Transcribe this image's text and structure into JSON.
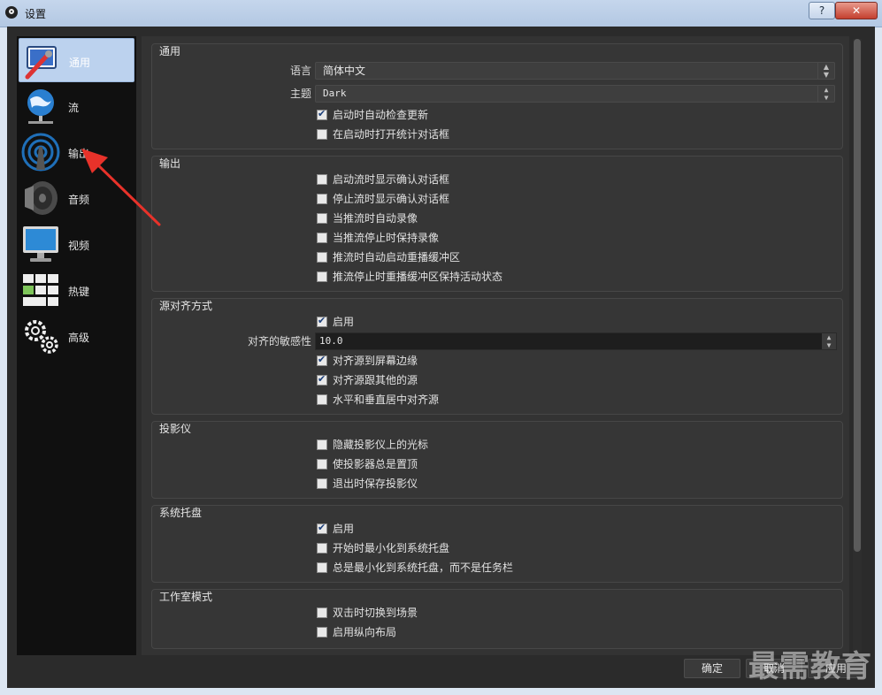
{
  "window": {
    "title": "设置",
    "help_label": "?",
    "close_label": "✕"
  },
  "sidebar": {
    "items": [
      {
        "label": "通用",
        "icon": "general-settings-icon"
      },
      {
        "label": "流",
        "icon": "globe-network-icon"
      },
      {
        "label": "输出",
        "icon": "antenna-signal-icon"
      },
      {
        "label": "音频",
        "icon": "speaker-icon"
      },
      {
        "label": "视频",
        "icon": "monitor-icon"
      },
      {
        "label": "热键",
        "icon": "keyboard-icon"
      },
      {
        "label": "高级",
        "icon": "gears-icon"
      }
    ]
  },
  "general": {
    "title": "通用",
    "language_label": "语言",
    "language_value": "简体中文",
    "theme_label": "主题",
    "theme_value": "Dark",
    "check_updates": {
      "label": "启动时自动检查更新",
      "checked": true
    },
    "open_stats": {
      "label": "在启动时打开统计对话框",
      "checked": false
    }
  },
  "output": {
    "title": "输出",
    "items": [
      {
        "label": "启动流时显示确认对话框",
        "checked": false
      },
      {
        "label": "停止流时显示确认对话框",
        "checked": false
      },
      {
        "label": "当推流时自动录像",
        "checked": false
      },
      {
        "label": "当推流停止时保持录像",
        "checked": false
      },
      {
        "label": "推流时自动启动重播缓冲区",
        "checked": false
      },
      {
        "label": "推流停止时重播缓冲区保持活动状态",
        "checked": false
      }
    ]
  },
  "snapping": {
    "title": "源对齐方式",
    "enable": {
      "label": "启用",
      "checked": true
    },
    "sensitivity_label": "对齐的敏感性",
    "sensitivity_value": "10.0",
    "items": [
      {
        "label": "对齐源到屏幕边缘",
        "checked": true
      },
      {
        "label": "对齐源跟其他的源",
        "checked": true
      },
      {
        "label": "水平和垂直居中对齐源",
        "checked": false
      }
    ]
  },
  "projector": {
    "title": "投影仪",
    "items": [
      {
        "label": "隐藏投影仪上的光标",
        "checked": false
      },
      {
        "label": "使投影器总是置顶",
        "checked": false
      },
      {
        "label": "退出时保存投影仪",
        "checked": false
      }
    ]
  },
  "tray": {
    "title": "系统托盘",
    "items": [
      {
        "label": "启用",
        "checked": true
      },
      {
        "label": "开始时最小化到系统托盘",
        "checked": false
      },
      {
        "label": "总是最小化到系统托盘，而不是任务栏",
        "checked": false
      }
    ]
  },
  "studio": {
    "title": "工作室模式",
    "items": [
      {
        "label": "双击时切换到场景",
        "checked": false
      },
      {
        "label": "启用纵向布局",
        "checked": false
      }
    ]
  },
  "buttons": {
    "ok": "确定",
    "cancel": "取消",
    "apply": "应用"
  },
  "watermark": "最需教育",
  "colors": {
    "accent_arrow": "#e8322a",
    "active_item_bg": "#bcd2ee"
  }
}
